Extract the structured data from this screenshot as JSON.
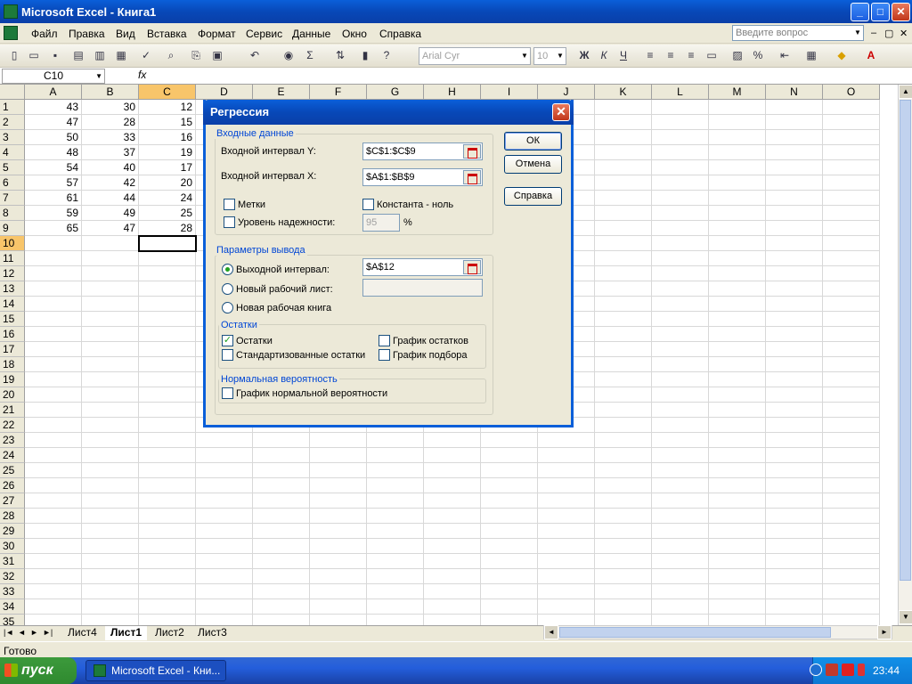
{
  "window": {
    "title": "Microsoft Excel - Книга1",
    "min": "_",
    "max": "□",
    "close": "✕"
  },
  "menu": [
    "Файл",
    "Правка",
    "Вид",
    "Вставка",
    "Формат",
    "Сервис",
    "Данные",
    "Окно",
    "Справка"
  ],
  "ask_box": {
    "placeholder": "Введите вопрос"
  },
  "doc_controls": {
    "min": "–",
    "restore": "▢",
    "close": "✕"
  },
  "toolbar": {
    "font": "Arial Cyr",
    "size": "10",
    "bold": "Ж",
    "italic": "К",
    "underline": "Ч",
    "percent": "%",
    "sum": "Σ"
  },
  "formula_bar": {
    "name_box": "C10",
    "fx": "fx"
  },
  "columns": [
    "A",
    "B",
    "C",
    "D",
    "E",
    "F",
    "G",
    "H",
    "I",
    "J",
    "K",
    "L",
    "M",
    "N",
    "O"
  ],
  "rows": [
    "1",
    "2",
    "3",
    "4",
    "5",
    "6",
    "7",
    "8",
    "9",
    "10",
    "11",
    "12",
    "13",
    "14",
    "15",
    "16",
    "17",
    "18",
    "19",
    "20",
    "21",
    "22",
    "23",
    "24",
    "25",
    "26",
    "27",
    "28",
    "29",
    "30",
    "31",
    "32",
    "33",
    "34",
    "35"
  ],
  "cells": {
    "A": [
      "43",
      "47",
      "50",
      "48",
      "54",
      "57",
      "61",
      "59",
      "65"
    ],
    "B": [
      "30",
      "28",
      "33",
      "37",
      "40",
      "42",
      "44",
      "49",
      "47"
    ],
    "C": [
      "12",
      "15",
      "16",
      "19",
      "17",
      "20",
      "24",
      "25",
      "28"
    ]
  },
  "sheets": {
    "tabs": [
      "Лист4",
      "Лист1",
      "Лист2",
      "Лист3"
    ],
    "active": "Лист1",
    "nav": [
      "|◄",
      "◄",
      "►",
      "►|"
    ]
  },
  "status": "Готово",
  "taskbar": {
    "start": "пуск",
    "item": "Microsoft Excel - Кни...",
    "clock": "23:44"
  },
  "dialog": {
    "title": "Регрессия",
    "input_group": "Входные данные",
    "y_label": "Входной интервал Y:",
    "y_value": "$C$1:$C$9",
    "x_label": "Входной интервал X:",
    "x_value": "$A$1:$B$9",
    "labels": "Метки",
    "const_zero": "Константа - ноль",
    "confidence": "Уровень надежности:",
    "confidence_value": "95",
    "percent": "%",
    "output_group": "Параметры вывода",
    "out_range": "Выходной интервал:",
    "out_range_value": "$A$12",
    "new_sheet": "Новый рабочий лист:",
    "new_book": "Новая рабочая книга",
    "residuals_group": "Остатки",
    "residuals": "Остатки",
    "std_residuals": "Стандартизованные остатки",
    "residual_plot": "График остатков",
    "fit_plot": "График подбора",
    "normal_group": "Нормальная вероятность",
    "normal_plot": "График нормальной вероятности",
    "ok": "ОК",
    "cancel": "Отмена",
    "help": "Справка",
    "residuals_checked": "✓"
  }
}
